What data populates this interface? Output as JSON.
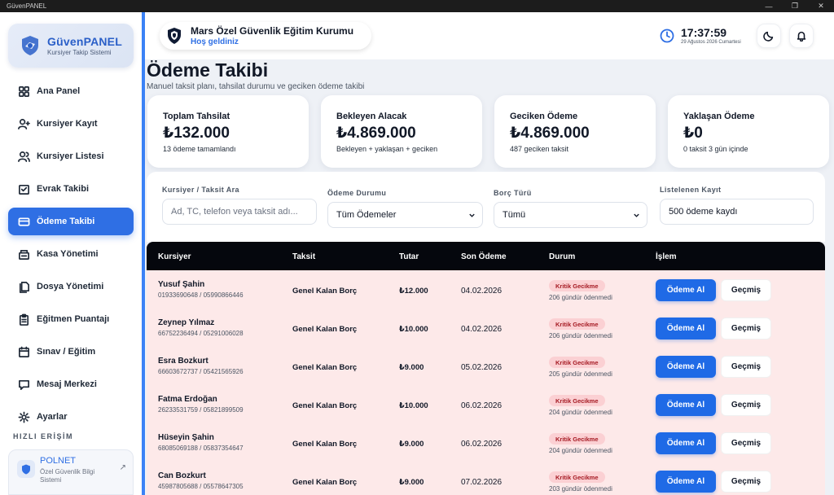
{
  "window": {
    "title": "GüvenPANEL",
    "controls": [
      "—",
      "❐",
      "✕"
    ]
  },
  "brand": {
    "name": "GüvenPANEL",
    "subtitle": "Kursiyer Takip Sistemi"
  },
  "sidebar": {
    "items": [
      {
        "label": "Ana Panel",
        "icon": "dashboard-icon"
      },
      {
        "label": "Kursiyer Kayıt",
        "icon": "user-plus-icon"
      },
      {
        "label": "Kursiyer Listesi",
        "icon": "users-icon"
      },
      {
        "label": "Evrak Takibi",
        "icon": "document-check-icon"
      },
      {
        "label": "Ödeme Takibi",
        "icon": "credit-card-icon",
        "active": true
      },
      {
        "label": "Kasa Yönetimi",
        "icon": "cash-register-icon"
      },
      {
        "label": "Dosya Yönetimi",
        "icon": "files-icon"
      },
      {
        "label": "Eğitmen Puantajı",
        "icon": "clipboard-icon"
      },
      {
        "label": "Sınav / Eğitim",
        "icon": "calendar-icon"
      },
      {
        "label": "Mesaj Merkezi",
        "icon": "message-icon"
      },
      {
        "label": "Ayarlar",
        "icon": "gear-icon"
      }
    ],
    "quick_access": {
      "title": "HIZLI ERİŞİM",
      "name": "POLNET",
      "subtitle": "Özel Güvenlik Bilgi Sistemi"
    }
  },
  "header": {
    "org_name": "Mars Özel Güvenlik Eğitim Kurumu",
    "welcome": "Hoş geldiniz",
    "time": "17:37:59",
    "date": "29 Ağustos 2026 Cumartesi"
  },
  "page": {
    "title": "Ödeme Takibi",
    "subtitle": "Manuel taksit planı, tahsilat durumu ve geciken ödeme takibi"
  },
  "stats": [
    {
      "title": "Toplam Tahsilat",
      "value": "₺132.000",
      "note": "13 ödeme tamamlandı"
    },
    {
      "title": "Bekleyen Alacak",
      "value": "₺4.869.000",
      "note": "Bekleyen + yaklaşan + geciken"
    },
    {
      "title": "Geciken Ödeme",
      "value": "₺4.869.000",
      "note": "487 geciken taksit"
    },
    {
      "title": "Yaklaşan Ödeme",
      "value": "₺0",
      "note": "0 taksit 3 gün içinde"
    }
  ],
  "filters": {
    "search_label": "Kursiyer / Taksit Ara",
    "search_placeholder": "Ad, TC, telefon veya taksit adı...",
    "status_label": "Ödeme Durumu",
    "status_value": "Tüm Ödemeler",
    "type_label": "Borç Türü",
    "type_value": "Tümü",
    "count_label": "Listelenen Kayıt",
    "count_value": "500 ödeme kaydı"
  },
  "table": {
    "headers": {
      "student": "Kursiyer",
      "installment": "Taksit",
      "amount": "Tutar",
      "due": "Son Ödeme",
      "status": "Durum",
      "action": "İşlem"
    },
    "pay_label": "Ödeme Al",
    "history_label": "Geçmiş",
    "rows": [
      {
        "name": "Yusuf Şahin",
        "ids": "01933690648 / 05990866446",
        "installment": "Genel Kalan Borç",
        "amount": "₺12.000",
        "due": "04.02.2026",
        "status": "Kritik Gecikme",
        "delay": "206 gündür ödenmedi"
      },
      {
        "name": "Zeynep Yılmaz",
        "ids": "66752236494 / 05291006028",
        "installment": "Genel Kalan Borç",
        "amount": "₺10.000",
        "due": "04.02.2026",
        "status": "Kritik Gecikme",
        "delay": "206 gündür ödenmedi"
      },
      {
        "name": "Esra Bozkurt",
        "ids": "66603672737 / 05421565926",
        "installment": "Genel Kalan Borç",
        "amount": "₺9.000",
        "due": "05.02.2026",
        "status": "Kritik Gecikme",
        "delay": "205 gündür ödenmedi"
      },
      {
        "name": "Fatma Erdoğan",
        "ids": "26233531759 / 05821899509",
        "installment": "Genel Kalan Borç",
        "amount": "₺10.000",
        "due": "06.02.2026",
        "status": "Kritik Gecikme",
        "delay": "204 gündür ödenmedi"
      },
      {
        "name": "Hüseyin Şahin",
        "ids": "68085069188 / 05837354647",
        "installment": "Genel Kalan Borç",
        "amount": "₺9.000",
        "due": "06.02.2026",
        "status": "Kritik Gecikme",
        "delay": "204 gündür ödenmedi"
      },
      {
        "name": "Can Bozkurt",
        "ids": "45987805688 / 05578647305",
        "installment": "Genel Kalan Borç",
        "amount": "₺9.000",
        "due": "07.02.2026",
        "status": "Kritik Gecikme",
        "delay": "203 gündür ödenmedi"
      }
    ]
  },
  "colors": {
    "accent": "#2f6fe4",
    "table_row_bg": "#fde9e9",
    "critical_badge_bg": "#fbd0d3",
    "critical_badge_text": "#a61b24",
    "table_header_bg": "#05070d"
  }
}
